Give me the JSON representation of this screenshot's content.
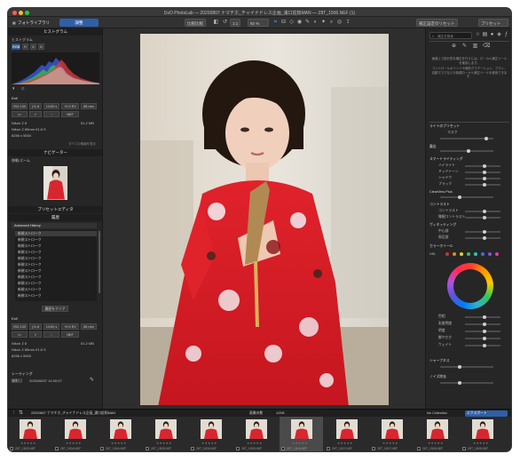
{
  "window": {
    "title": "DxO PhotoLab — 20200807 ナマチホ_チャイナドレス企画_浦口佐知MAN — Z8T_1506.NEF (1)"
  },
  "toolbar": {
    "tab_library": "フォトライブラリ",
    "tab_customize": "調整",
    "compare_label": "比較比較",
    "zoom_fit": "1:1",
    "zoom_value": "92 %",
    "reset_label": "補正設定のリセット",
    "presets_label": "プリセット"
  },
  "left_panel": {
    "histogram_title": "ヒストグラム",
    "histogram_label": "ヒストグラム",
    "histogram_mode_chip": "RGB",
    "histogram_channels": [
      "R",
      "G",
      "B"
    ],
    "exif_title": "Exif",
    "exif_values": [
      "ISO 100",
      "ƒ/1.8",
      "1/100 s",
      "+0.0 EV",
      "85 mm"
    ],
    "camera_model": "Nikon Z 8",
    "lens_model": "Nikon Z 85mm f/1.8 S",
    "image_size": "8256 x 5504",
    "file_size": "51.2 MB",
    "file_format": "NEF",
    "show_info": "すべての情報を表示",
    "navigator_title": "ナビゲーター",
    "navigator_label": "移動/ズーム",
    "history_title": "履歴",
    "preset_editor_title": "プリセットエディタ",
    "history_group": "Advanced History",
    "history_items": [
      "新規ストローク",
      "新規ストローク",
      "新規ストローク",
      "新規ストローク",
      "新規ストローク",
      "新規ストローク",
      "新規ストローク",
      "新規ストローク",
      "新規ストローク",
      "新規ストローク",
      "新規ストローク"
    ],
    "history_clear": "履歴をクリア",
    "exif2_title": "Exif",
    "exif2_camera": "Nikon Z 8",
    "exif2_lens": "Nikon Z 85mm f/1.8 S",
    "exif2_size": "8256 x 5504",
    "rating_title": "レーティング",
    "date_label": "2020/08/07 14:00:07",
    "date_prefix": "撮影日"
  },
  "right_panel": {
    "search_placeholder": "補正を検索",
    "hint_text": "画面上で部分的な補正を行うには、ローカル補正ツールを使用します。",
    "hint_text2": "コントロールポイントや線形グラデーション、ブラシ、自動マスクなどの各種ローカル補正ツールを使用できます。",
    "group_lighting": "ライトのプリセット",
    "group_lighting_sub": "マスク",
    "row_exposure": "露出",
    "row_smart_lighting": "スマートライティング",
    "sub_items": [
      "ハイライト",
      "ミッドトーン",
      "シャドウ",
      "ブラック"
    ],
    "smart_label": "スマート",
    "row_clearview": "ClearView Plus",
    "row_contrast": "コントラスト",
    "sub_contrast": [
      "コントラスト",
      "微細コントラスト"
    ],
    "row_microcontrast": "微細コントラスト",
    "row_vignetting": "ヴィネッティング",
    "sub_vignetting": [
      "中心部",
      "周辺部"
    ],
    "row_color": "カラーホイール",
    "row_hsl": "HSL",
    "color_rows": [
      "色相",
      "彩度明度",
      "明度",
      "鮮やかさ",
      "ウェイト"
    ],
    "row_sharpen": "シャープネス",
    "row_noise": "ノイズ除去",
    "color_dots": [
      "#cc3333",
      "#e08a2a",
      "#e0d040",
      "#3fbf4f",
      "#35c0c0",
      "#3a6fe0",
      "#8a4fe0",
      "#d040b0"
    ]
  },
  "filmstrip": {
    "path": "20200807 ナマチホ_チャイナドレス企画_浦口佐知MAN",
    "count_label": "画像の数",
    "count_value": "1/208",
    "collection_label": "Ink Collection",
    "export_label": "エクスポート",
    "thumbs": [
      {
        "label": "Z8T_1503.NEF",
        "stars": "★★★★★"
      },
      {
        "label": "Z8T_1504.NEF",
        "stars": "★★★★★"
      },
      {
        "label": "Z8T_1504.NEF",
        "stars": "★★★★★"
      },
      {
        "label": "Z8T_1505.NEF",
        "stars": "★★★★★"
      },
      {
        "label": "Z8T_1505.NEF",
        "stars": "★★★★★"
      },
      {
        "label": "Z8T_1505.NEF",
        "stars": "★★★★★"
      },
      {
        "label": "Z8T_1506.NEF",
        "stars": "★★★★★"
      },
      {
        "label": "Z8T_1507.NEF",
        "stars": "★★★★★"
      },
      {
        "label": "Z8T_1507.NEF",
        "stars": "★★★★★"
      },
      {
        "label": "Z8T_1508.NEF",
        "stars": "★★★★★"
      },
      {
        "label": "Z8T_1508.NEF",
        "stars": "★★★★★"
      }
    ]
  }
}
